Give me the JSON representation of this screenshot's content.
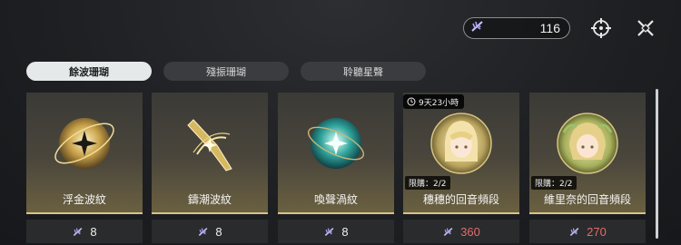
{
  "header": {
    "currency_value": "116",
    "currency_icon": "feather-currency-icon",
    "target_icon": "crosshair-icon",
    "close_icon": "close-icon"
  },
  "tabs": [
    {
      "label": "餘波珊瑚",
      "active": true
    },
    {
      "label": "殘振珊瑚",
      "active": false
    },
    {
      "label": "聆聽星聲",
      "active": false
    }
  ],
  "items": [
    {
      "name": "浮金波紋",
      "price": "8",
      "icon": "golden-orb-icon"
    },
    {
      "name": "鑄潮波紋",
      "price": "8",
      "icon": "golden-blade-icon"
    },
    {
      "name": "喚聲渦紋",
      "price": "8",
      "icon": "teal-orb-icon"
    },
    {
      "name": "穗穗的回音頻段",
      "price": "360",
      "limit": "限購：2/2",
      "timer": "9天23小時",
      "icon": "character-portrait-icon"
    },
    {
      "name": "維里奈的回音頻段",
      "price": "270",
      "limit": "限購：2/2",
      "icon": "character-portrait-icon"
    }
  ],
  "colors": {
    "accent_red": "#e56a6a",
    "gold_line": "#d8c48a",
    "active_tab": "#e6e9ea"
  }
}
